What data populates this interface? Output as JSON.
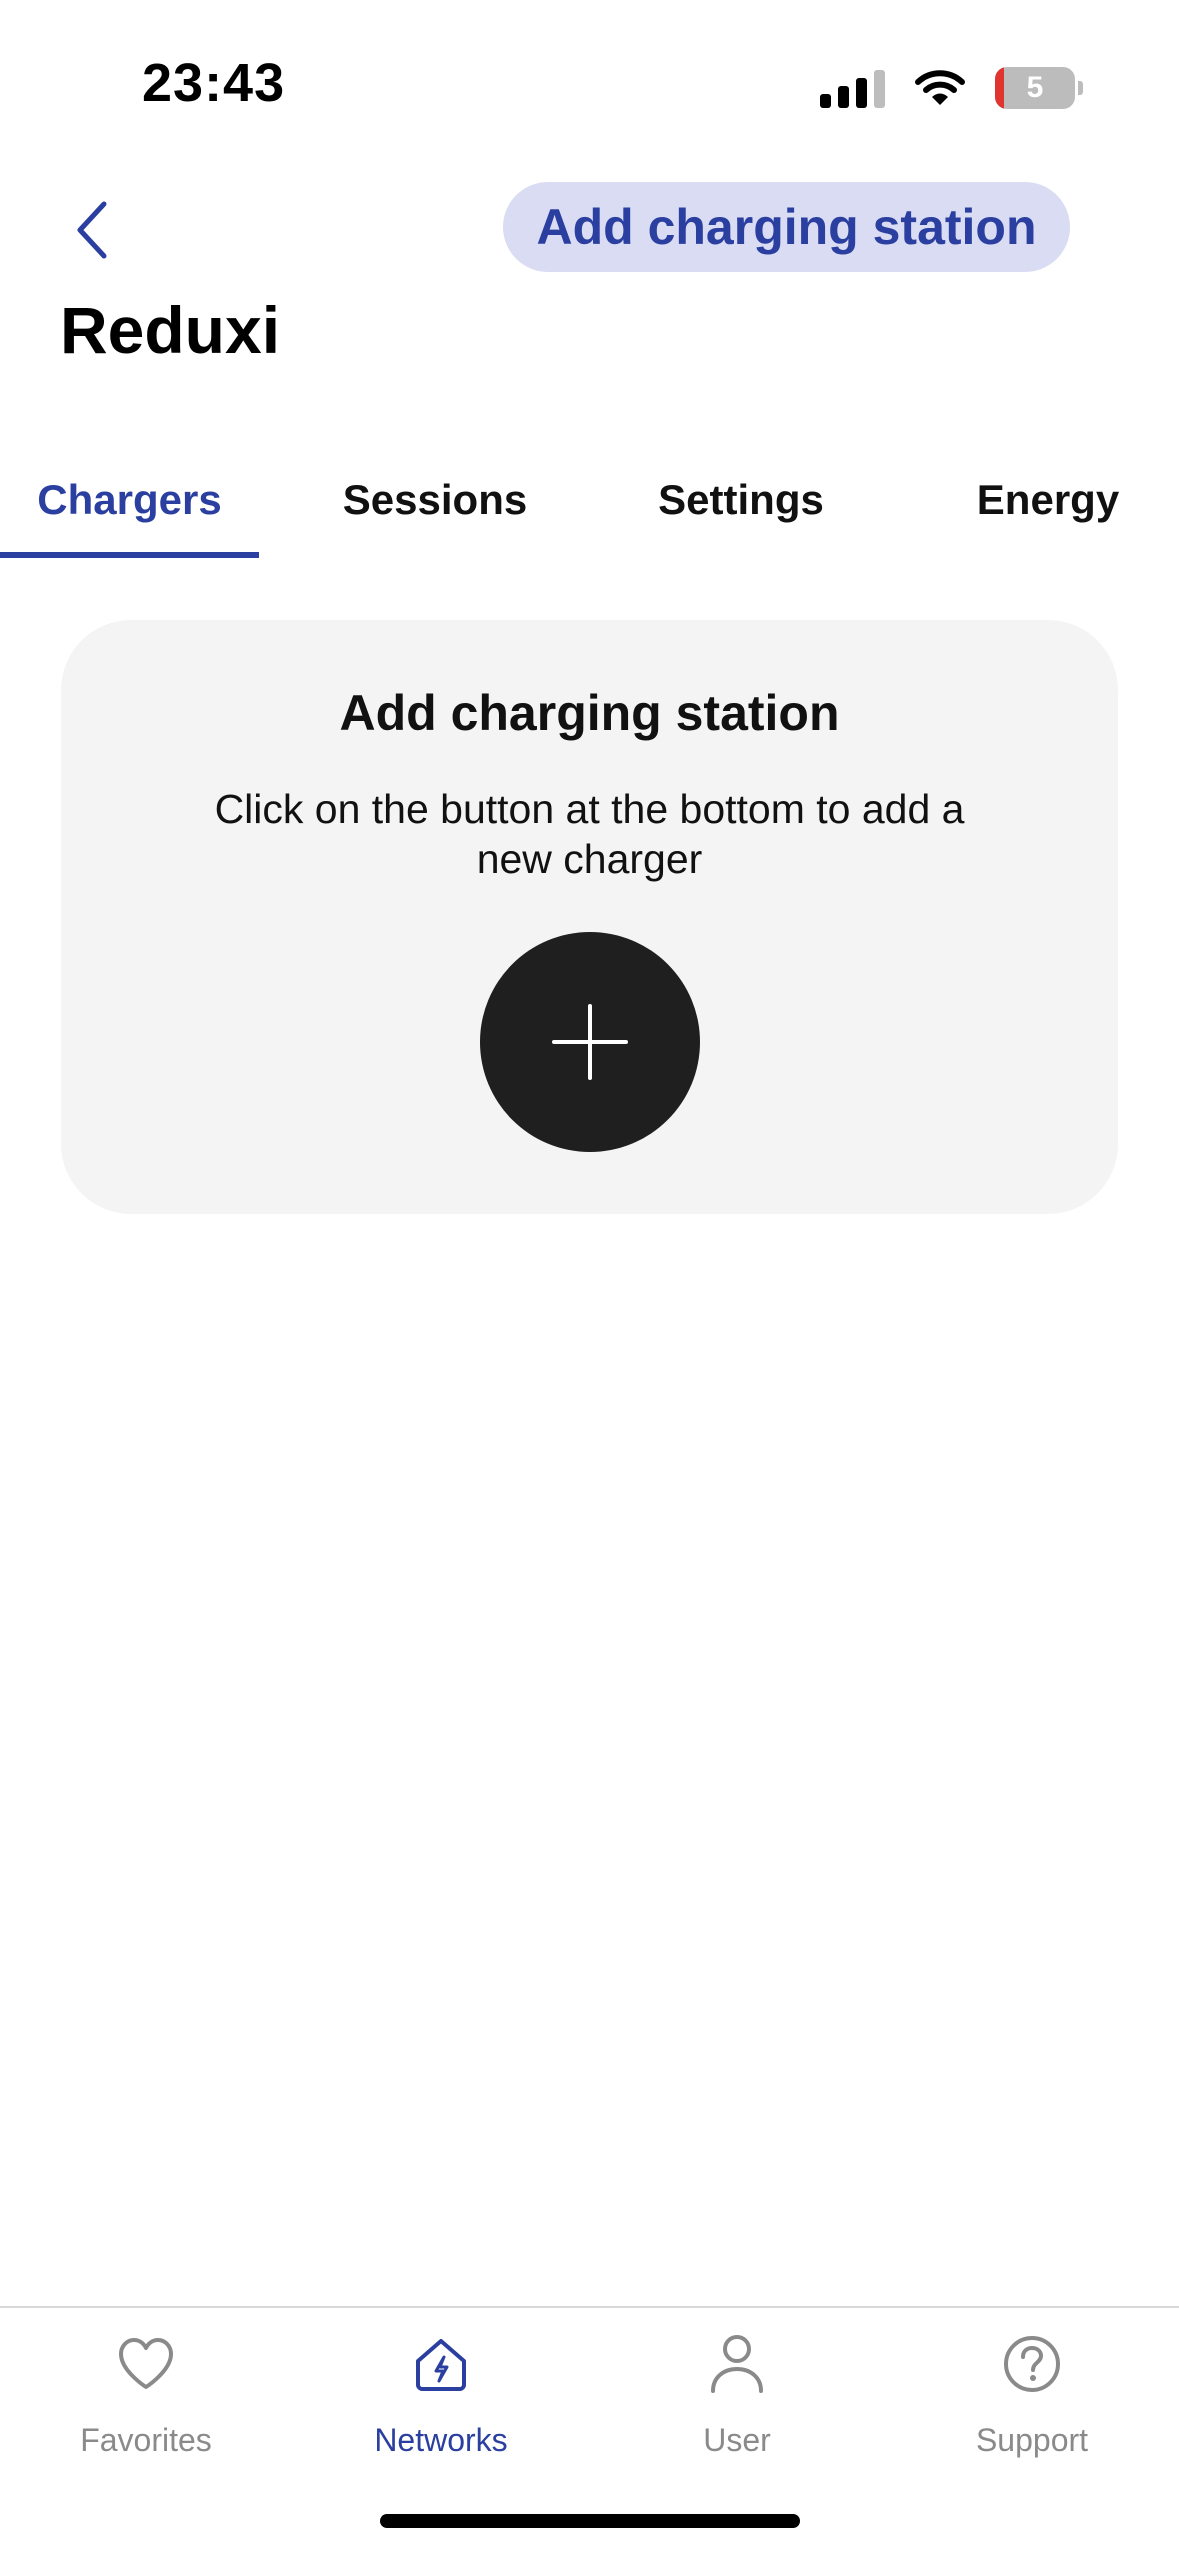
{
  "status_bar": {
    "time": "23:43",
    "battery_level": "5",
    "icons": [
      "cellular-signal-icon",
      "wifi-icon",
      "battery-icon"
    ]
  },
  "header": {
    "back_icon": "chevron-left-icon",
    "add_button_label": "Add charging station",
    "title": "Reduxi"
  },
  "tabs": [
    {
      "label": "Chargers",
      "active": true
    },
    {
      "label": "Sessions",
      "active": false
    },
    {
      "label": "Settings",
      "active": false
    },
    {
      "label": "Energy",
      "active": false
    }
  ],
  "empty_state": {
    "title": "Add charging station",
    "text": "Click on the button at the bottom to add a new charger",
    "button_icon": "plus-icon"
  },
  "bottom_nav": [
    {
      "label": "Favorites",
      "icon": "heart-icon",
      "active": false
    },
    {
      "label": "Networks",
      "icon": "house-bolt-icon",
      "active": true
    },
    {
      "label": "User",
      "icon": "user-icon",
      "active": false
    },
    {
      "label": "Support",
      "icon": "question-circle-icon",
      "active": false
    }
  ],
  "colors": {
    "accent": "#2b3fa0",
    "accent_light": "#d9dcf2",
    "card_bg": "#f4f4f4",
    "dark_button": "#1f1f1f",
    "inactive_nav": "#8a8a8a",
    "battery_low": "#e0342e"
  }
}
